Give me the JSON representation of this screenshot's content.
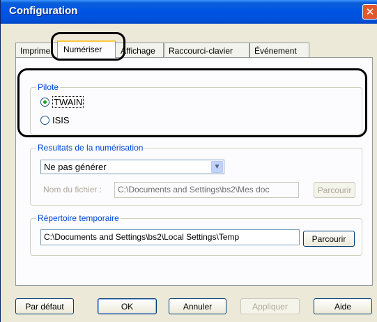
{
  "window": {
    "title": "Configuration",
    "close_glyph": "✕"
  },
  "tabs": [
    "Imprimer",
    "Numériser",
    "Affichage",
    "Raccourci-clavier",
    "Événement"
  ],
  "pilote": {
    "title": "Pilote",
    "options": [
      {
        "label": "TWAIN",
        "selected": true
      },
      {
        "label": "ISIS",
        "selected": false
      }
    ]
  },
  "resultats": {
    "title": "Resultats de la numérisation",
    "select_value": "Ne pas générer",
    "filename_label": "Nom du fichier :",
    "filename_value": "C:\\Documents and Settings\\bs2\\Mes doc",
    "browse_label": "Parcourir"
  },
  "temp": {
    "title": "Répertoire temporaire",
    "path_value": "C:\\Documents and Settings\\bs2\\Local Settings\\Temp",
    "browse_label": "Parcourir"
  },
  "footer": {
    "default_label": "Par défaut",
    "ok_label": "OK",
    "cancel_label": "Annuler",
    "apply_label": "Appliquer",
    "help_label": "Aide"
  },
  "colors": {
    "title_bar": "#0054e3",
    "group_title": "#0046d5",
    "radio_dot": "#21a121",
    "active_tab_accent": "#ffc83c"
  }
}
